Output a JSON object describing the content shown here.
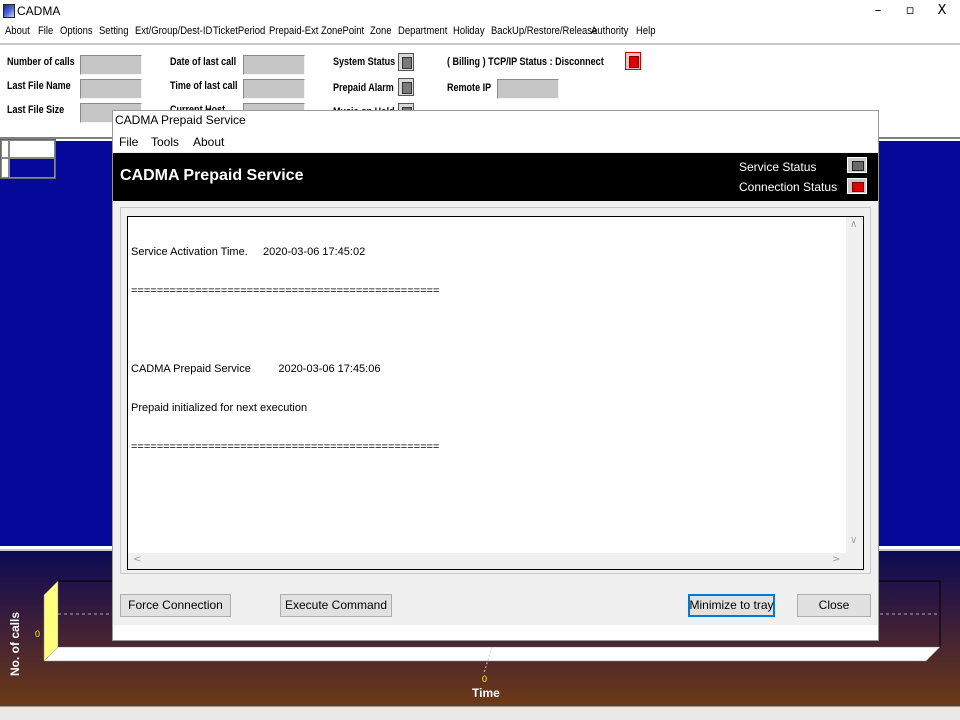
{
  "app": {
    "title": "CADMA",
    "window_buttons": {
      "minimize": "–",
      "restore": "▫",
      "close": "X"
    }
  },
  "menu": [
    "About",
    "File",
    "Options",
    "Setting",
    "Ext/Group/Dest-ID",
    "TicketPeriod",
    "Prepaid-Ext",
    "ZonePoint",
    "Zone",
    "Department",
    "Holiday",
    "BackUp/Restore/Release",
    "Authority",
    "Help"
  ],
  "status_panel": {
    "number_of_calls": "Number of  calls",
    "last_file_name": "Last File Name",
    "last_file_size": "Last File Size",
    "date_of_last_call": "Date of last call",
    "time_of_last_call": "Time of last call",
    "current_host": "Current Host",
    "system_status": "System Status",
    "prepaid_alarm": "Prepaid Alarm",
    "music_on_hold": "Music on Hold",
    "billing_status": "( Billing ) TCP/IP Status : Disconnect",
    "remote_ip": "Remote IP"
  },
  "chart": {
    "ylabel": "No. of calls",
    "xlabel": "Time",
    "y_tick": "0",
    "x_tick": "0"
  },
  "dialog": {
    "title": "CADMA Prepaid Service",
    "menu": [
      "File",
      "Tools",
      "About"
    ],
    "banner_title": "CADMA Prepaid Service",
    "service_status_label": "Service Status",
    "connection_status_label": "Connection Status",
    "log_lines": [
      "Service Activation Time.     2020-03-06 17:45:02",
      "================================================",
      "",
      "CADMA Prepaid Service         2020-03-06 17:45:06",
      "Prepaid initialized for next execution",
      "================================================"
    ],
    "buttons": {
      "force_connection": "Force Connection",
      "execute_command": "Execute Command",
      "minimize_to_tray": "Minimize to tray",
      "close": "Close"
    }
  },
  "colors": {
    "workspace_blue": "#05099a",
    "indicator_red": "#e00000",
    "banner_black": "#000000"
  }
}
